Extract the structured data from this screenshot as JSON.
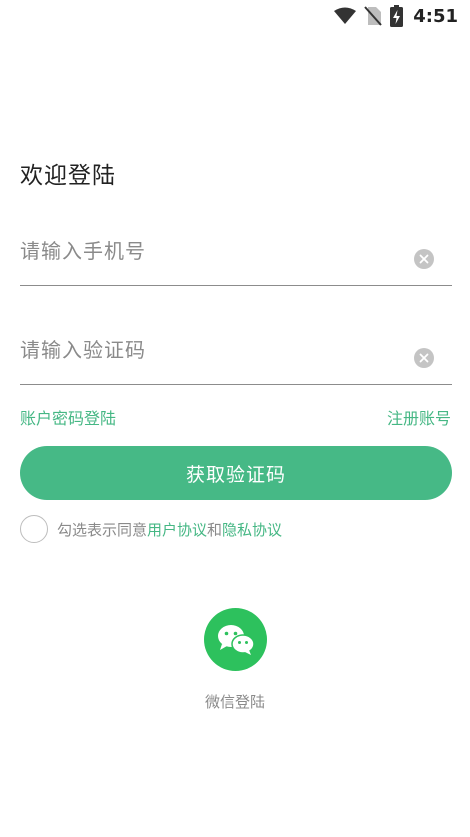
{
  "status_bar": {
    "time": "4:51",
    "icons": [
      "wifi-icon",
      "no-sim-icon",
      "battery-charging-icon"
    ]
  },
  "login": {
    "title": "欢迎登陆",
    "phone_placeholder": "请输入手机号",
    "code_placeholder": "请输入验证码",
    "password_login_link": "账户密码登陆",
    "register_link": "注册账号",
    "get_code_button": "获取验证码",
    "agreement": {
      "prefix": "勾选表示同意",
      "user_agreement": "用户协议",
      "conjunction": "和",
      "privacy_agreement": "隐私协议"
    },
    "wechat_login_label": "微信登陆"
  },
  "colors": {
    "accent": "#46b986",
    "wechat": "#2dc15d",
    "muted_text": "#8a8a8a"
  }
}
